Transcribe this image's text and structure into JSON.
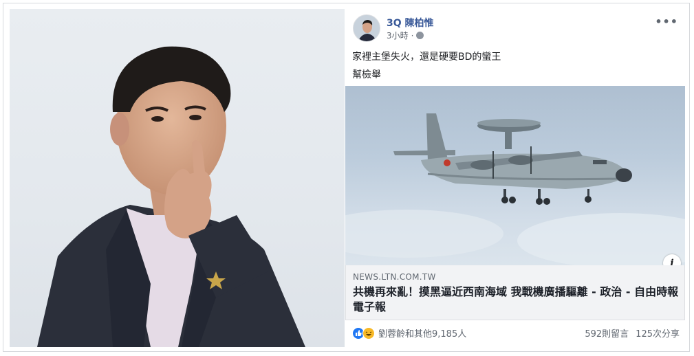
{
  "post": {
    "author": "3Q 陳柏惟",
    "time": "3小時",
    "privacy_icon": "globe-icon",
    "more_icon": "more-icon",
    "text_line1": "家裡主堡失火，還是硬要BD的蠻王",
    "text_line2": "幫檢舉"
  },
  "link": {
    "domain": "NEWS.LTN.COM.TW",
    "headline": "共機再來亂！摸黑逼近西南海域 我戰機廣播驅離 - 政治 - 自由時報電子報",
    "info_label": "i"
  },
  "footer": {
    "reactions_text": "劉蓉齡和其他9,185人",
    "comments": "592則留言",
    "shares": "125次分享"
  },
  "colors": {
    "author": "#385898",
    "like": "#2078f4",
    "haha": "#f7b928",
    "link_bg": "#f2f3f5"
  }
}
